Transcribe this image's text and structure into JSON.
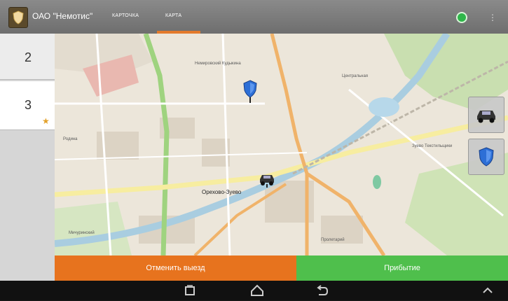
{
  "header": {
    "app_title": "ОАО \"Немотис\"",
    "tabs": [
      {
        "label": "КАРТОЧКА",
        "active": false
      },
      {
        "label": "КАРТА",
        "active": true
      }
    ],
    "status": "online",
    "icons": {
      "logo": "shield-logo-icon",
      "status": "green-status-dot-icon",
      "overflow": "overflow-menu-icon"
    }
  },
  "sidebar": {
    "items": [
      {
        "number": "2",
        "favorite": false
      },
      {
        "number": "3",
        "favorite": true
      }
    ]
  },
  "map": {
    "labels": {
      "city": "Орехово-Зуево",
      "district_north": "Немировский Кудыкина",
      "district_center": "Центральная",
      "station_east": "Зуево Текстильщики",
      "district_south": "Пролетарий",
      "park": "Мичуринский",
      "area_west": "Родина"
    },
    "markers": [
      {
        "type": "shield-marker-icon"
      },
      {
        "type": "car-marker-icon"
      }
    ],
    "side_buttons": [
      {
        "icon": "car-icon"
      },
      {
        "icon": "shield-icon"
      }
    ]
  },
  "actions": {
    "cancel_label": "Отменить выезд",
    "arrive_label": "Прибытие"
  },
  "colors": {
    "accent": "#e37a2b",
    "cancel": "#e7731e",
    "arrive": "#4fbf4c",
    "header": "#7a7a7a"
  },
  "system_nav": {
    "icons": [
      "recent-apps-icon",
      "home-icon",
      "back-icon",
      "chevron-up-icon"
    ]
  }
}
